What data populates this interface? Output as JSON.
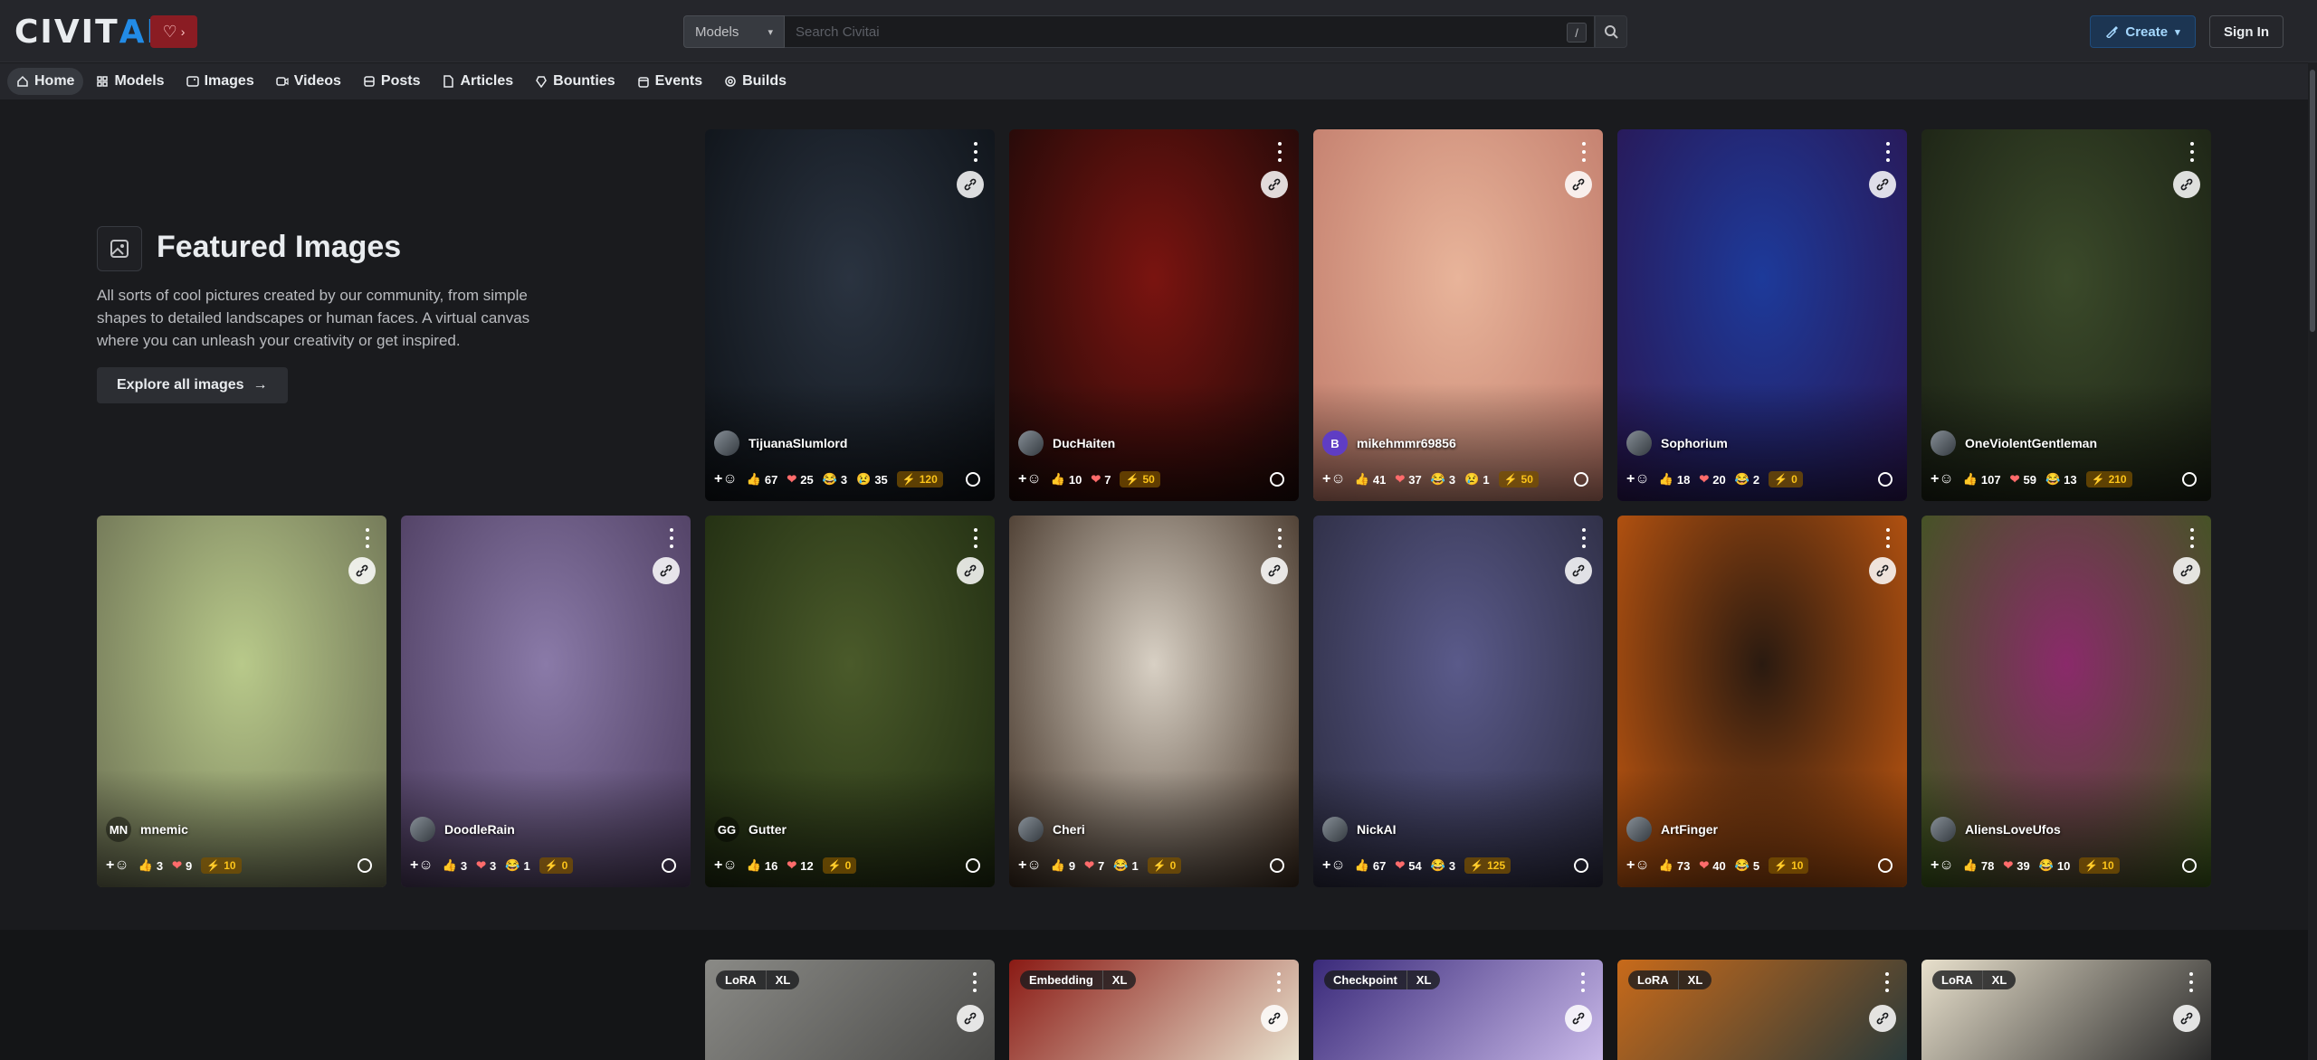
{
  "header": {
    "logo_civ": "CIVIT",
    "logo_ai": "AI",
    "search_type": "Models",
    "search_placeholder": "Search Civitai",
    "search_kbd": "/",
    "create_label": "Create",
    "signin_label": "Sign In"
  },
  "nav": {
    "items": [
      {
        "label": "Home",
        "icon": "home-icon",
        "active": true
      },
      {
        "label": "Models",
        "icon": "models-icon"
      },
      {
        "label": "Images",
        "icon": "image-icon"
      },
      {
        "label": "Videos",
        "icon": "video-icon"
      },
      {
        "label": "Posts",
        "icon": "posts-icon"
      },
      {
        "label": "Articles",
        "icon": "article-icon"
      },
      {
        "label": "Bounties",
        "icon": "bounty-icon"
      },
      {
        "label": "Events",
        "icon": "calendar-icon"
      },
      {
        "label": "Builds",
        "icon": "builds-icon"
      }
    ]
  },
  "featured": {
    "title": "Featured Images",
    "description": "All sorts of cool pictures created by our community, from simple shapes to detailed landscapes or human faces. A virtual canvas where you can unleash your creativity or get inspired.",
    "explore_label": "Explore all images"
  },
  "images_row1": [
    {
      "user": "TijuanaSlumlord",
      "like": "67",
      "heart": "25",
      "laugh": "3",
      "cry": "35",
      "buzz": "120",
      "bg1": "#2a3340",
      "bg2": "#0d1116"
    },
    {
      "user": "DucHaiten",
      "like": "10",
      "heart": "7",
      "buzz": "50",
      "bg1": "#7a1410",
      "bg2": "#1a0908"
    },
    {
      "user": "mikehmmr69856",
      "avatar": "B",
      "like": "41",
      "heart": "37",
      "laugh": "3",
      "cry": "1",
      "buzz": "50",
      "bg1": "#e8b49a",
      "bg2": "#c07a6a"
    },
    {
      "user": "Sophorium",
      "like": "18",
      "heart": "20",
      "laugh": "2",
      "buzz": "0",
      "bg1": "#1d3a9a",
      "bg2": "#2a1550"
    },
    {
      "user": "OneViolentGentleman",
      "like": "107",
      "heart": "59",
      "laugh": "13",
      "buzz": "210",
      "bg1": "#3b4a2a",
      "bg2": "#1a2014"
    }
  ],
  "images_row2": [
    {
      "user": "mnemic",
      "avatar": "MN",
      "like": "3",
      "heart": "9",
      "buzz": "10",
      "bg1": "#b8c98a",
      "bg2": "#6a6e52"
    },
    {
      "user": "DoodleRain",
      "like": "3",
      "heart": "3",
      "laugh": "1",
      "buzz": "0",
      "bg1": "#8a7aa8",
      "bg2": "#4a3a5c"
    },
    {
      "user": "Gutter",
      "avatar": "GG",
      "like": "16",
      "heart": "12",
      "buzz": "0",
      "bg1": "#4a5a2a",
      "bg2": "#1e2a10"
    },
    {
      "user": "Cheri",
      "like": "9",
      "heart": "7",
      "laugh": "1",
      "buzz": "0",
      "bg1": "#d8d0c4",
      "bg2": "#3a2a1e"
    },
    {
      "user": "NickAI",
      "like": "67",
      "heart": "54",
      "laugh": "3",
      "buzz": "125",
      "bg1": "#5a5a8a",
      "bg2": "#2a2a3e"
    },
    {
      "user": "ArtFinger",
      "like": "73",
      "heart": "40",
      "laugh": "5",
      "buzz": "10",
      "bg1": "#2a1a10",
      "bg2": "#c85a10"
    },
    {
      "user": "AliensLoveUfos",
      "like": "78",
      "heart": "39",
      "laugh": "10",
      "buzz": "10",
      "bg1": "#8a2a6a",
      "bg2": "#3a5a1a"
    }
  ],
  "models": [
    {
      "type": "LoRA",
      "base": "XL",
      "bg1": "#8a8a86",
      "bg2": "#4a4a48"
    },
    {
      "type": "Embedding",
      "base": "XL",
      "bg1": "#8a1a14",
      "bg2": "#e8e0cc"
    },
    {
      "type": "Checkpoint",
      "base": "XL",
      "bg1": "#3a2a7a",
      "bg2": "#c8b8e8"
    },
    {
      "type": "LoRA",
      "base": "XL",
      "bg1": "#c86a1a",
      "bg2": "#2a3a3a"
    },
    {
      "type": "LoRA",
      "base": "XL",
      "bg1": "#e8e0cc",
      "bg2": "#2a2a2a"
    }
  ]
}
